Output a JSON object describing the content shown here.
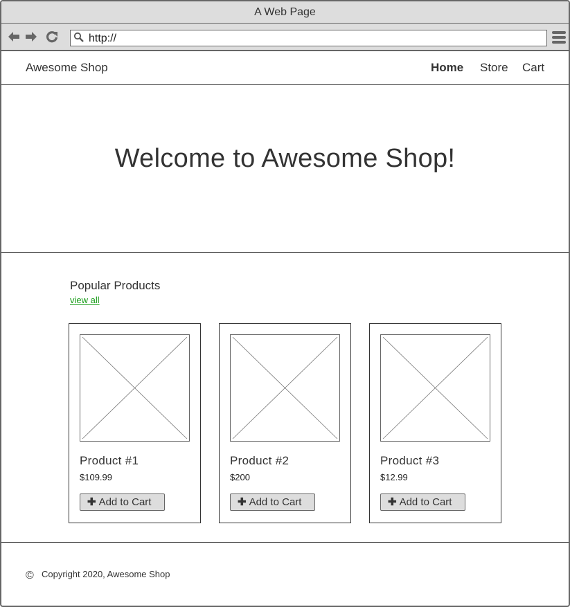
{
  "browser": {
    "title": "A Web Page",
    "url": "http://",
    "icons": {
      "back": "arrow-left-icon",
      "forward": "arrow-right-icon",
      "reload": "reload-icon",
      "search": "search-icon",
      "menu": "hamburger-menu-icon"
    }
  },
  "header": {
    "brand": "Awesome Shop",
    "nav": [
      {
        "label": "Home",
        "active": true
      },
      {
        "label": "Store",
        "active": false
      },
      {
        "label": "Cart",
        "active": false
      }
    ]
  },
  "hero": {
    "title": "Welcome to Awesome Shop!"
  },
  "products_section": {
    "title": "Popular Products",
    "view_all": "view all",
    "link_color": "#159b15",
    "products": [
      {
        "name": "Product #1",
        "price": "$109.99",
        "button": "Add to Cart",
        "button_icon": "plus-icon"
      },
      {
        "name": "Product #2",
        "price": "$200",
        "button": "Add to Cart",
        "button_icon": "plus-icon"
      },
      {
        "name": "Product #3",
        "price": "$12.99",
        "button": "Add to Cart",
        "button_icon": "plus-icon"
      }
    ]
  },
  "footer": {
    "icon": "copyright-icon",
    "symbol": "©",
    "text": "Copyright 2020, Awesome Shop"
  }
}
